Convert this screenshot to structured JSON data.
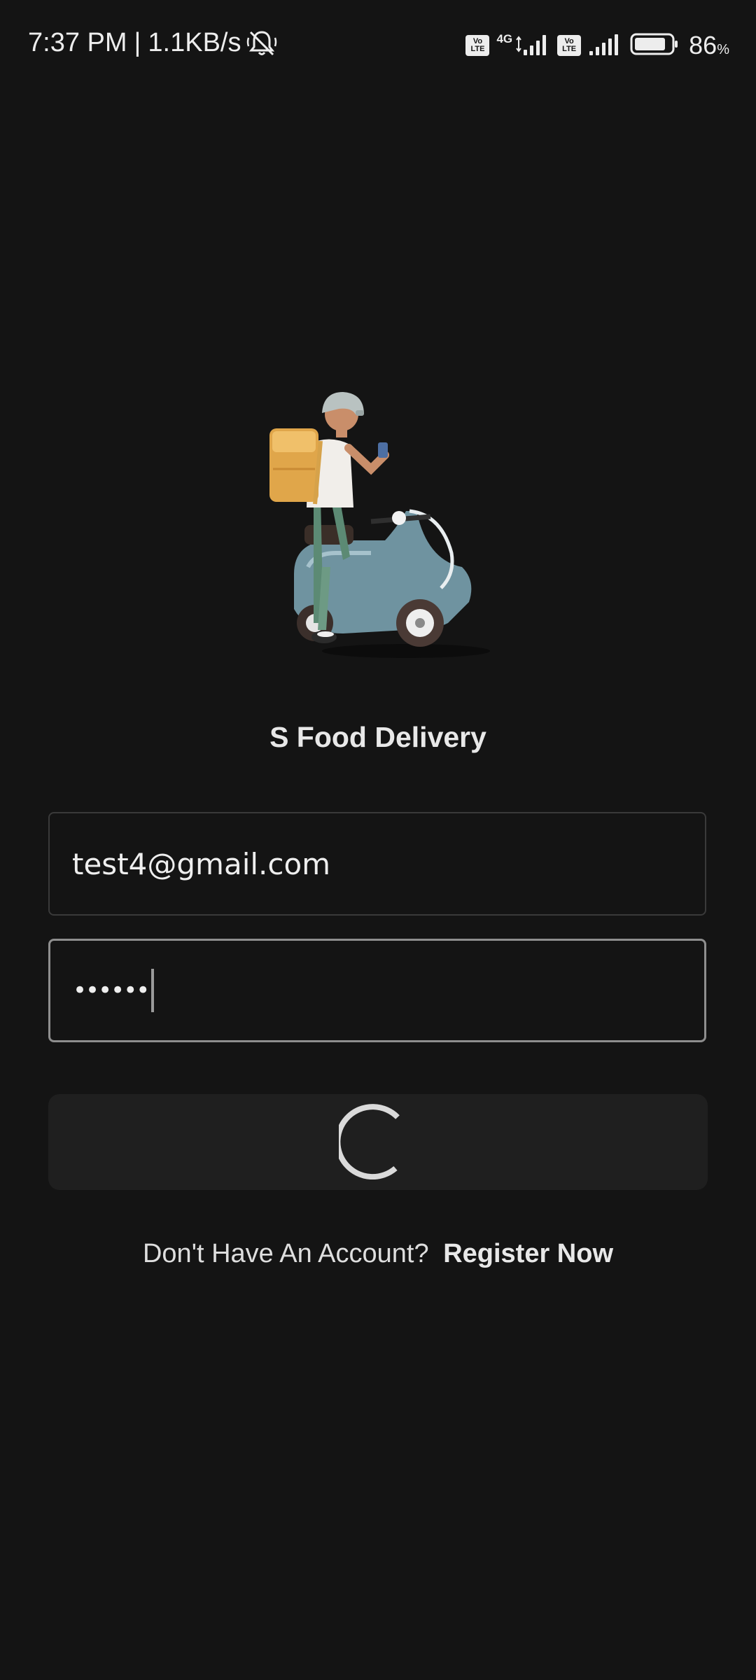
{
  "status_bar": {
    "time": "7:37 PM",
    "separator": "|",
    "net_speed": "1.1KB/s",
    "bell_icon": "bell-off-icon",
    "sim1_badge": "Vo LTE",
    "network_type": "4G",
    "sim2_badge": "Vo LTE",
    "battery_level": 86,
    "battery_text": "86",
    "battery_unit": "%"
  },
  "app": {
    "title": "S Food Delivery",
    "illustration": "delivery-rider-scooter-illustration"
  },
  "login_form": {
    "email_value": "test4@gmail.com",
    "password_masked": "••••••",
    "button_state": "loading",
    "loading_icon": "spinner-icon"
  },
  "register": {
    "prompt": "Don't Have An Account?",
    "link_label": "Register Now"
  },
  "colors": {
    "background": "#141414",
    "field_border": "#3a3a3a",
    "focused_border": "#8e8e8e",
    "button_bg": "#1f1f1f",
    "text": "#e6e6e6"
  }
}
